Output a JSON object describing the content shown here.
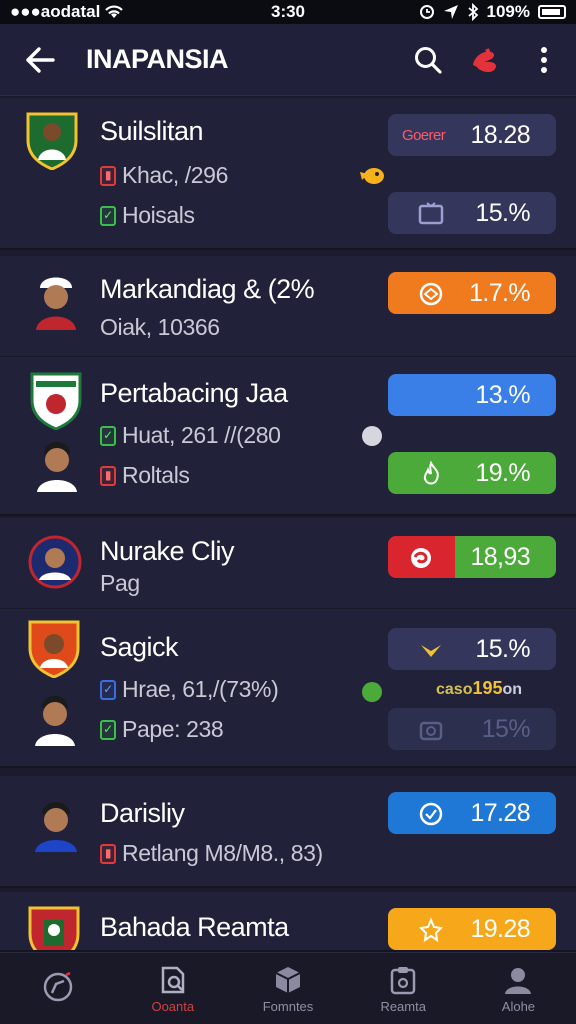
{
  "status_bar": {
    "carrier": "●●●aodatal",
    "time": "3:30",
    "battery": "109%"
  },
  "header": {
    "title": "INAPANSIA"
  },
  "players": [
    {
      "name": "Suilslitan",
      "lines": [
        {
          "text": "Khac, /296",
          "mark": "red"
        },
        {
          "text": "Hoisals",
          "mark": "green"
        }
      ],
      "stats": [
        {
          "label": "Goerer",
          "value": "18.28"
        },
        {
          "value": "15.%"
        }
      ]
    },
    {
      "name": "Markandiag & (2%",
      "lines": [
        {
          "text": "Oiak, 10366"
        }
      ],
      "stats": [
        {
          "value": "1.7.%"
        }
      ]
    },
    {
      "name": "Pertabacing Jaa",
      "lines": [
        {
          "text": "Huat, 261 //(280",
          "mark": "green"
        },
        {
          "text": "Roltals",
          "mark": "red"
        }
      ],
      "stats": [
        {
          "value": "13.%"
        },
        {
          "value": "19.%"
        }
      ]
    },
    {
      "name": "Nurake Cliy",
      "lines": [
        {
          "text": "Pag"
        }
      ],
      "stats": [
        {
          "value": "18,93"
        }
      ]
    },
    {
      "name": "Sagick",
      "lines": [
        {
          "text": "Hrae, 61,/(73%)",
          "mark": "blue"
        },
        {
          "text": "Pape: 238",
          "mark": "green"
        }
      ],
      "stats": [
        {
          "value": "15.%"
        },
        {
          "label": "caso",
          "value": "195",
          "suffix": "on"
        },
        {
          "value": "15%"
        }
      ]
    },
    {
      "name": "Darisliy",
      "lines": [
        {
          "text": "Retlang M8/M8., 83)",
          "mark": "red"
        }
      ],
      "stats": [
        {
          "value": "17.28"
        }
      ]
    },
    {
      "name": "Bahada Reamta",
      "lines": [],
      "stats": [
        {
          "value": "19.28"
        }
      ]
    }
  ],
  "nav": [
    {
      "label": "",
      "icon": "compass-icon"
    },
    {
      "label": "Ooanta",
      "icon": "search-doc-icon"
    },
    {
      "label": "Fomntes",
      "icon": "cube-icon"
    },
    {
      "label": "Reamta",
      "icon": "clipboard-icon"
    },
    {
      "label": "Alohe",
      "icon": "person-icon"
    }
  ],
  "colors": {
    "background": "#1c1b2e",
    "card": "#21213a",
    "accent_red": "#e2323a",
    "orange": "#f07a1e",
    "blue": "#3a7ee8",
    "green": "#4caa3a",
    "yellow": "#f6a81a"
  }
}
